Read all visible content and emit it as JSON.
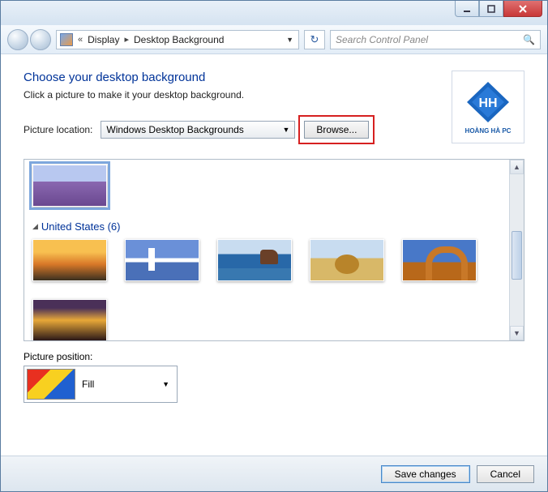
{
  "titlebar": {
    "min_icon": "minimize-icon",
    "max_icon": "maximize-icon",
    "close_icon": "close-icon"
  },
  "navbar": {
    "chevrons": "«",
    "crumb1": "Display",
    "sep": "▸",
    "crumb2": "Desktop Background",
    "search_placeholder": "Search Control Panel"
  },
  "main": {
    "heading": "Choose your desktop background",
    "subtext": "Click a picture to make it your desktop background.",
    "location_label": "Picture location:",
    "location_value": "Windows Desktop Backgrounds",
    "browse_label": "Browse...",
    "logo_text": "HOÀNG HÀ PC"
  },
  "gallery": {
    "group_label": "United States (6)"
  },
  "position": {
    "label": "Picture position:",
    "value": "Fill"
  },
  "footer": {
    "save": "Save changes",
    "cancel": "Cancel"
  }
}
